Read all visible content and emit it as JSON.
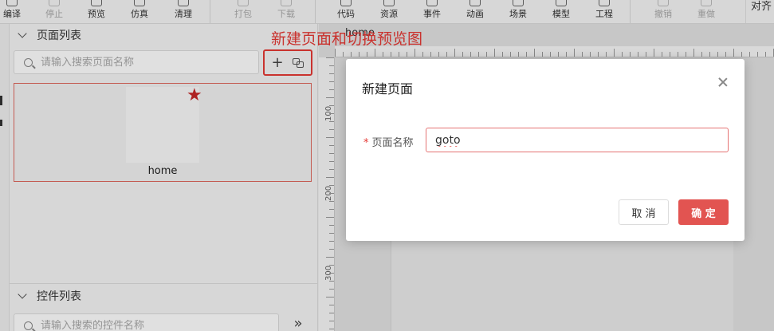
{
  "toolbar": {
    "items": [
      {
        "label": "编译",
        "icon": "compile-icon",
        "disabled": false
      },
      {
        "label": "停止",
        "icon": "stop-icon",
        "disabled": true
      },
      {
        "label": "预览",
        "icon": "preview-icon",
        "disabled": false
      },
      {
        "label": "仿真",
        "icon": "simulate-icon",
        "disabled": false
      },
      {
        "label": "清理",
        "icon": "clean-icon",
        "disabled": false
      },
      {
        "label": "打包",
        "icon": "package-icon",
        "disabled": true
      },
      {
        "label": "下载",
        "icon": "download-icon",
        "disabled": true
      },
      {
        "label": "代码",
        "icon": "code-icon",
        "disabled": false
      },
      {
        "label": "资源",
        "icon": "resource-icon",
        "disabled": false
      },
      {
        "label": "事件",
        "icon": "event-icon",
        "disabled": false
      },
      {
        "label": "动画",
        "icon": "animation-icon",
        "disabled": false
      },
      {
        "label": "场景",
        "icon": "scene-icon",
        "disabled": false
      },
      {
        "label": "模型",
        "icon": "model-icon",
        "disabled": false
      },
      {
        "label": "工程",
        "icon": "project-icon",
        "disabled": false
      },
      {
        "label": "撤销",
        "icon": "undo-icon",
        "disabled": true
      },
      {
        "label": "重做",
        "icon": "redo-icon",
        "disabled": true
      }
    ],
    "align_label": "对齐"
  },
  "page_list": {
    "title": "页面列表",
    "search_placeholder": "请输入搜索页面名称",
    "add_icon": "+",
    "pages": [
      {
        "name": "home"
      }
    ]
  },
  "annotation": "新建页面和切换预览图",
  "control_list": {
    "title": "控件列表",
    "search_placeholder": "请输入搜索的控件名称",
    "expand_glyph": "»"
  },
  "canvas": {
    "tab": "home",
    "ruler_left_labels": [
      "100",
      "200",
      "300"
    ]
  },
  "dialog": {
    "title": "新建页面",
    "field_required_mark": "*",
    "field_label": "页面名称",
    "field_value": "goto",
    "cancel_label": "取 消",
    "ok_label": "确 定"
  },
  "colors": {
    "accent": "#e25451",
    "annotation": "#e53935",
    "highlight_border": "#e0685e",
    "star": "#c62828"
  }
}
